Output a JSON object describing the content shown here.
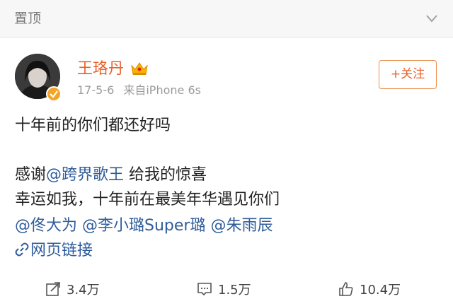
{
  "pinned": {
    "label": "置顶"
  },
  "author": {
    "name": "王珞丹",
    "date": "17-5-6",
    "source": "来自iPhone 6s"
  },
  "follow_button": {
    "label": "+关注"
  },
  "post": {
    "line1": "十年前的你们都还好吗",
    "line2_prefix": "感谢",
    "line2_mention": "@跨界歌王",
    "line2_suffix": " 给我的惊喜",
    "line3": "幸运如我，十年前在最美年华遇见你们",
    "mentions": [
      "@佟大为",
      "@李小璐Super璐",
      "@朱雨辰"
    ],
    "link_text": "网页链接"
  },
  "actions": {
    "repost": "3.4万",
    "comment": "1.5万",
    "like": "10.4万"
  },
  "colors": {
    "username": "#e8632c",
    "mention": "#2f5d9b",
    "follow_border": "#ec8c4a"
  },
  "icons": [
    "chevron-down-icon",
    "verified-badge-icon",
    "crown-icon",
    "link-icon",
    "repost-icon",
    "comment-icon",
    "like-icon"
  ]
}
